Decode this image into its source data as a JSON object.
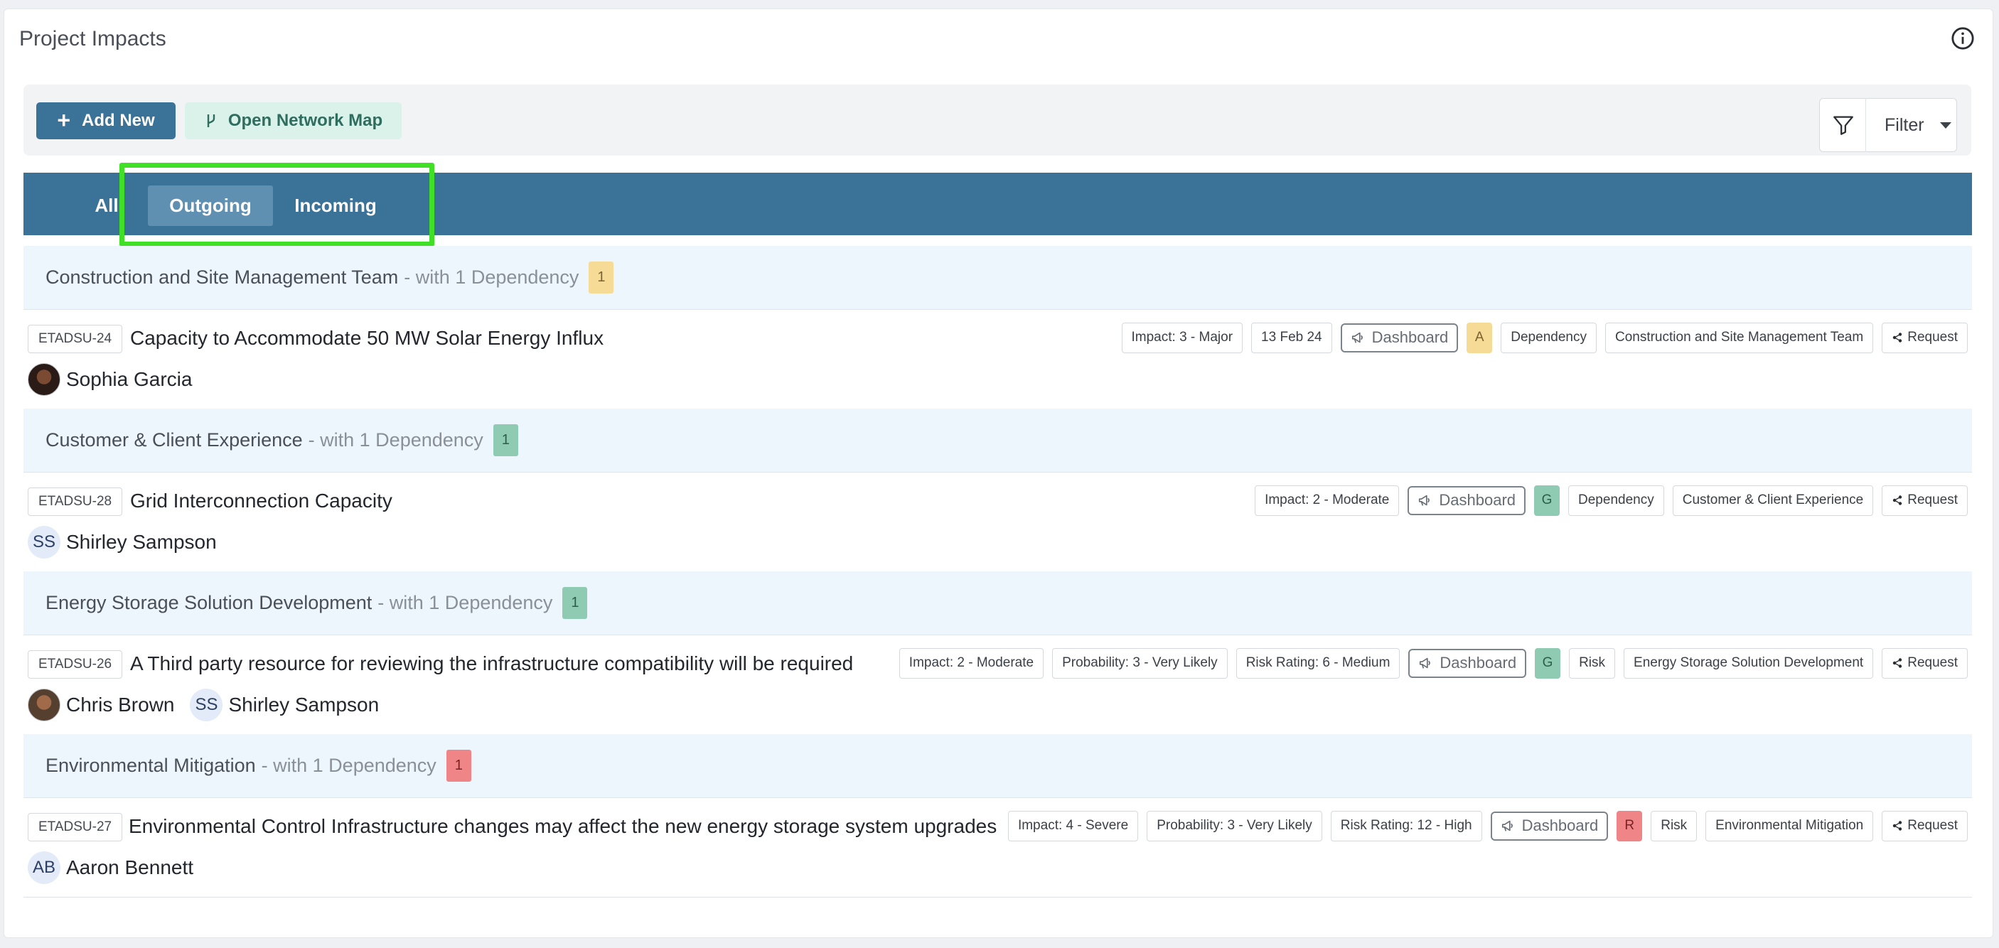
{
  "page": {
    "title": "Project Impacts",
    "info_icon": "info-circle-icon"
  },
  "toolbar": {
    "add_new_label": "Add New",
    "add_icon": "plus-icon",
    "open_network_map_label": "Open Network Map",
    "network_icon": "branch-icon",
    "filter_label": "Filter",
    "filter_icon": "funnel-icon"
  },
  "tabs": [
    {
      "label": "All",
      "active": false
    },
    {
      "label": "Outgoing",
      "active": true
    },
    {
      "label": "Incoming",
      "active": false
    }
  ],
  "colors": {
    "primary": "#3b7398",
    "highlight_outline": "#3fe026",
    "amber": "#f6db96",
    "green": "#8ecbb2",
    "red": "#ef8587"
  },
  "groups": [
    {
      "name": "Construction and Site Management Team",
      "suffix": "- with 1 Dependency",
      "count": "1",
      "status": "amber",
      "item": {
        "id": "ETADSU-24",
        "title": "Capacity to Accommodate 50 MW Solar Energy Influx",
        "assignees": [
          {
            "name": "Sophia Garcia",
            "avatar": "photo"
          }
        ],
        "chips": [
          "Impact: 3 - Major",
          "13 Feb 24"
        ],
        "dashboard_label": "Dashboard",
        "rag": "A",
        "type": "Dependency",
        "team": "Construction and Site Management Team",
        "request_label": "Request"
      }
    },
    {
      "name": "Customer & Client Experience",
      "suffix": "- with 1 Dependency",
      "count": "1",
      "status": "green",
      "item": {
        "id": "ETADSU-28",
        "title": "Grid Interconnection Capacity",
        "assignees": [
          {
            "name": "Shirley Sampson",
            "initials": "SS"
          }
        ],
        "chips": [
          "Impact: 2 - Moderate"
        ],
        "dashboard_label": "Dashboard",
        "rag": "G",
        "type": "Dependency",
        "team": "Customer & Client Experience",
        "request_label": "Request"
      }
    },
    {
      "name": "Energy Storage Solution Development",
      "suffix": "- with 1 Dependency",
      "count": "1",
      "status": "green",
      "item": {
        "id": "ETADSU-26",
        "title": "A Third party resource for reviewing the infrastructure compatibility will be required",
        "assignees": [
          {
            "name": "Chris Brown",
            "avatar": "photo"
          },
          {
            "name": "Shirley Sampson",
            "initials": "SS"
          }
        ],
        "chips": [
          "Impact: 2 - Moderate",
          "Probability: 3 - Very Likely",
          "Risk Rating: 6 - Medium"
        ],
        "dashboard_label": "Dashboard",
        "rag": "G",
        "type": "Risk",
        "team": "Energy Storage Solution Development",
        "request_label": "Request"
      }
    },
    {
      "name": "Environmental Mitigation",
      "suffix": "- with 1 Dependency",
      "count": "1",
      "status": "red",
      "item": {
        "id": "ETADSU-27",
        "title": "Environmental Control Infrastructure changes may affect the new energy storage system upgrades",
        "assignees": [
          {
            "name": "Aaron Bennett",
            "initials": "AB"
          }
        ],
        "chips": [
          "Impact: 4 - Severe",
          "Probability: 3 - Very Likely",
          "Risk Rating: 12 - High"
        ],
        "dashboard_label": "Dashboard",
        "rag": "R",
        "type": "Risk",
        "team": "Environmental Mitigation",
        "request_label": "Request"
      }
    }
  ]
}
